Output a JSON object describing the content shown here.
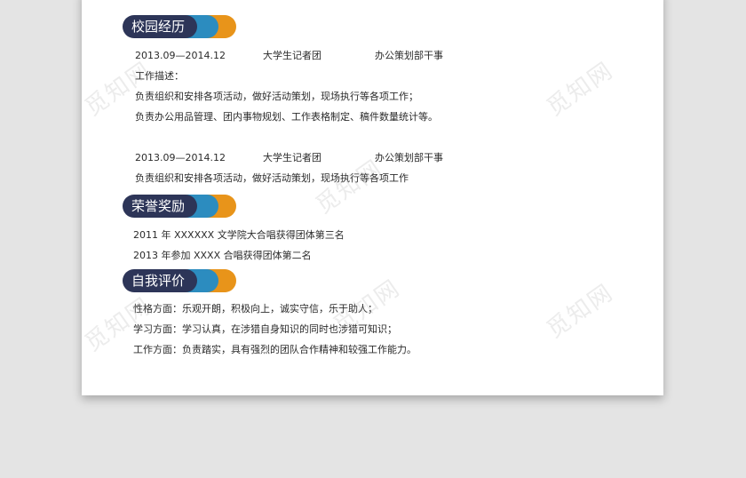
{
  "sections": {
    "campus": {
      "title": "校园经历",
      "entries": [
        {
          "dates": "2013.09—2014.12",
          "org": "大学生记者团",
          "role": "办公策划部干事",
          "desc_label": "工作描述：",
          "lines": [
            "负责组织和安排各项活动，做好活动策划，现场执行等各项工作；",
            "负责办公用品管理、团内事物规划、工作表格制定、稿件数量统计等。"
          ]
        },
        {
          "dates": "2013.09—2014.12",
          "org": "大学生记者团",
          "role": "办公策划部干事",
          "lines": [
            "负责组织和安排各项活动，做好活动策划，现场执行等各项工作"
          ]
        }
      ]
    },
    "honors": {
      "title": "荣誉奖励",
      "lines": [
        "2011 年 XXXXXX 文学院大合唱获得团体第三名",
        "2013 年参加 XXXX 合唱获得团体第二名"
      ]
    },
    "self": {
      "title": "自我评价",
      "lines": [
        "性格方面：乐观开朗，积极向上，诚实守信，乐于助人；",
        "学习方面：学习认真，在涉猎自身知识的同时也涉猎可知识；",
        "工作方面：负责踏实，具有强烈的团队合作精神和较强工作能力。"
      ]
    }
  },
  "watermark_text": "觅知网",
  "colors": {
    "navy": "#2d3558",
    "blue": "#2c8cbf",
    "orange": "#e8941a",
    "background": "#e4e4e4",
    "paper": "#ffffff"
  }
}
